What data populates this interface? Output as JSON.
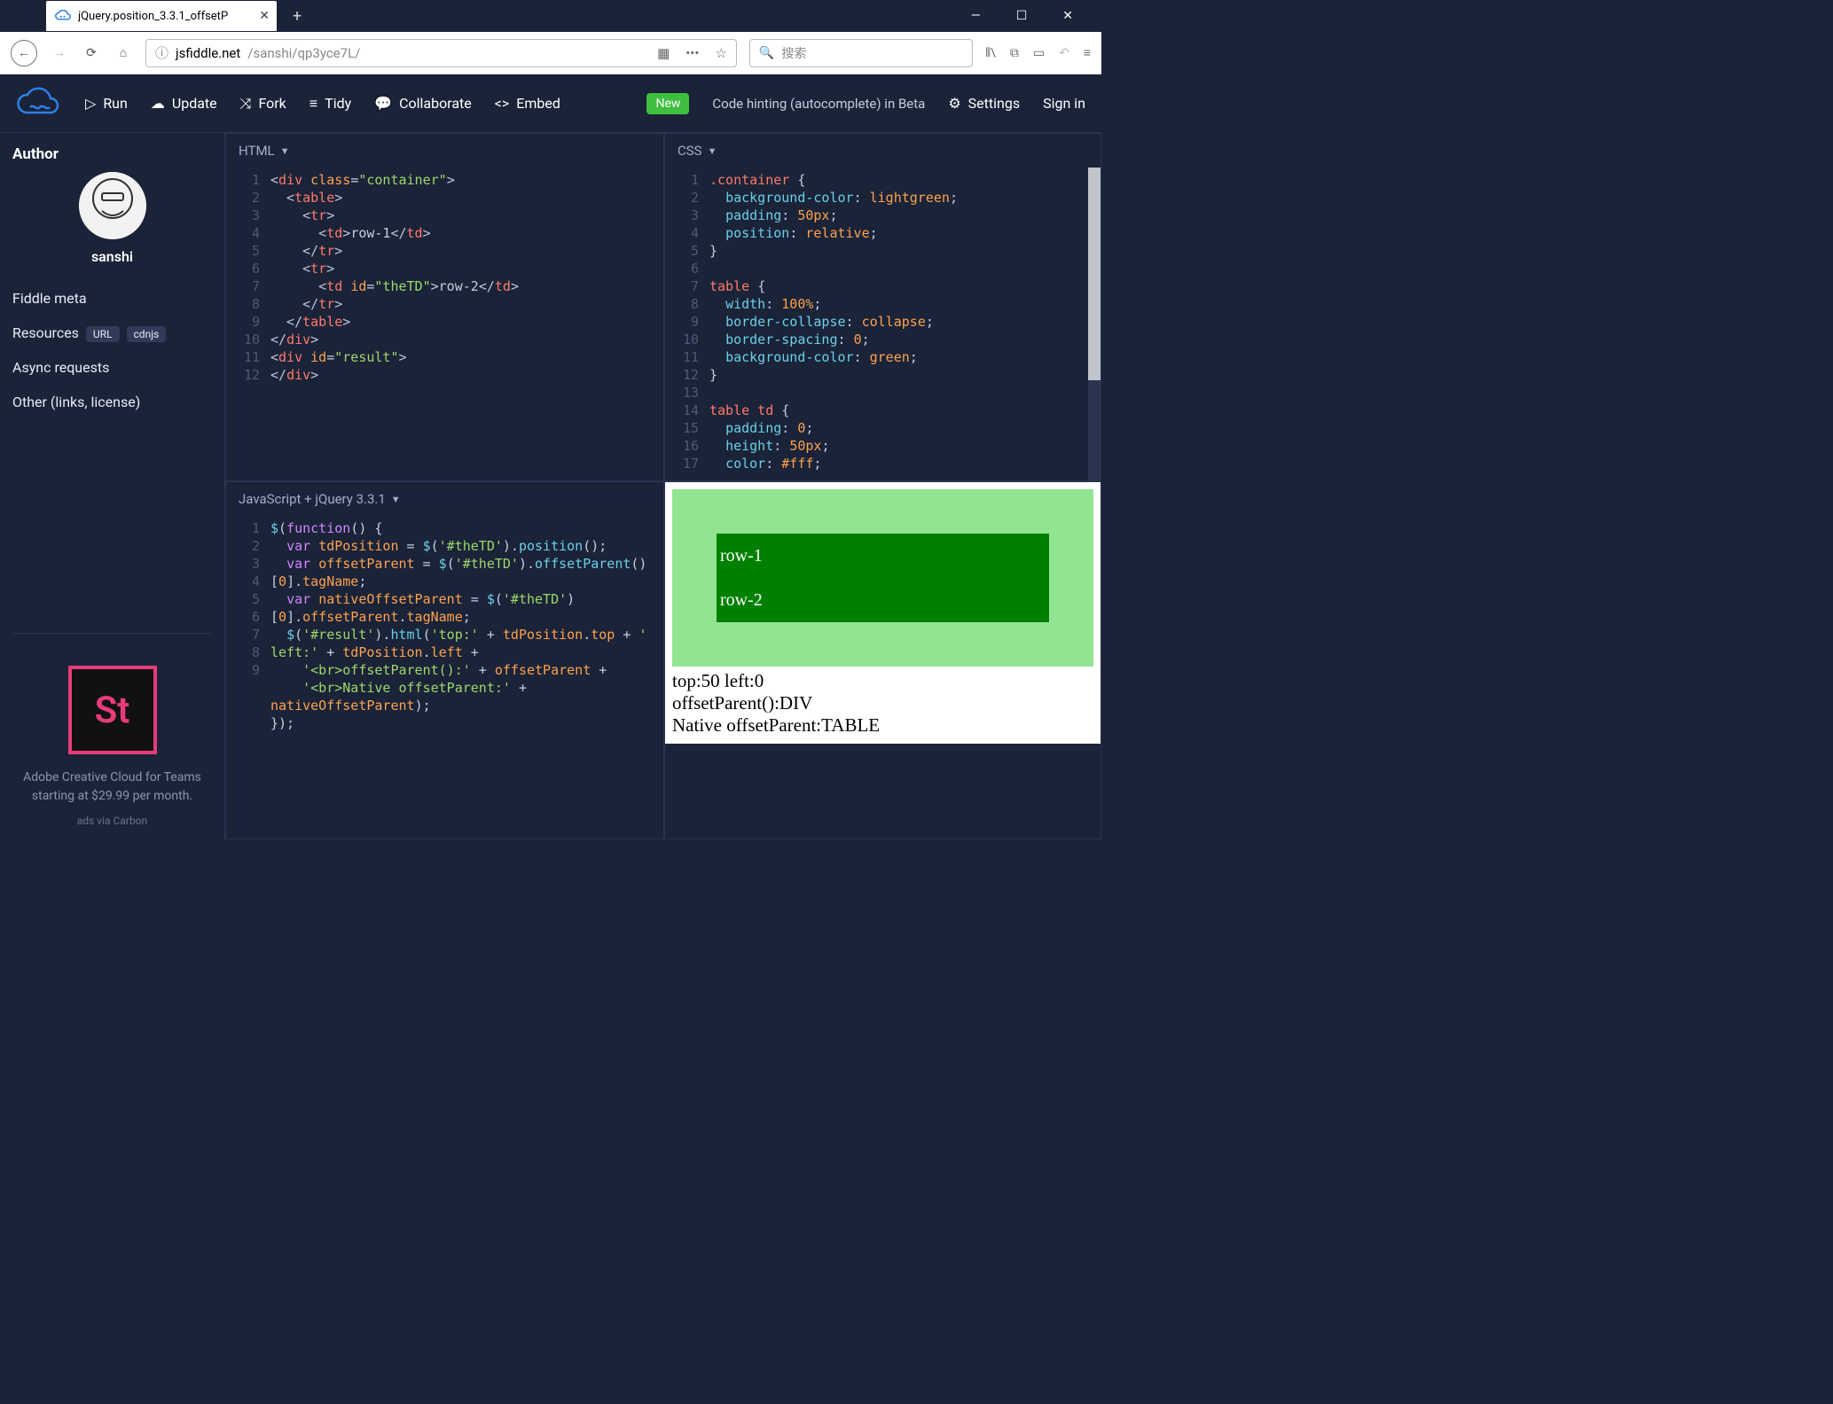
{
  "browser": {
    "tab_title": "jQuery.position_3.3.1_offsetP",
    "url_host": "jsfiddle.net",
    "url_path": "/sanshi/qp3yce7L/",
    "search_placeholder": "搜索"
  },
  "toolbar": {
    "run": "Run",
    "update": "Update",
    "fork": "Fork",
    "tidy": "Tidy",
    "collaborate": "Collaborate",
    "embed": "Embed",
    "new_label": "New",
    "hint": "Code hinting (autocomplete) in Beta",
    "settings": "Settings",
    "signin": "Sign in"
  },
  "sidebar": {
    "author_heading": "Author",
    "author_name": "sanshi",
    "links": {
      "fiddle_meta": "Fiddle meta",
      "resources": "Resources",
      "url_pill": "URL",
      "cdnjs_pill": "cdnjs",
      "async": "Async requests",
      "other": "Other (links, license)"
    },
    "ad": {
      "tile_text": "St",
      "copy": "Adobe Creative Cloud for Teams starting at $29.99 per month.",
      "via": "ads via Carbon"
    }
  },
  "panels": {
    "html_label": "HTML",
    "css_label": "CSS",
    "js_label": "JavaScript + jQuery 3.3.1"
  },
  "html_code": {
    "lines": [
      "1",
      "2",
      "3",
      "4",
      "5",
      "6",
      "7",
      "8",
      "9",
      "10",
      "11",
      "12"
    ],
    "l1": {
      "a": "<",
      "b": "div ",
      "c": "class",
      "d": "=",
      "e": "\"container\"",
      "f": ">"
    },
    "l2": {
      "a": "  <",
      "b": "table",
      "c": ">"
    },
    "l3": {
      "a": "    <",
      "b": "tr",
      "c": ">"
    },
    "l4": {
      "a": "      <",
      "b": "td",
      "c": ">",
      "d": "row-1",
      "e": "</",
      "f": "td",
      "g": ">"
    },
    "l5": {
      "a": "    </",
      "b": "tr",
      "c": ">"
    },
    "l6": {
      "a": "    <",
      "b": "tr",
      "c": ">"
    },
    "l7": {
      "a": "      <",
      "b": "td ",
      "c": "id",
      "d": "=",
      "e": "\"theTD\"",
      "f": ">",
      "g": "row-2",
      "h": "</",
      "i": "td",
      "j": ">"
    },
    "l8": {
      "a": "    </",
      "b": "tr",
      "c": ">"
    },
    "l9": {
      "a": "  </",
      "b": "table",
      "c": ">"
    },
    "l10": {
      "a": "</",
      "b": "div",
      "c": ">"
    },
    "l11": {
      "a": "<",
      "b": "div ",
      "c": "id",
      "d": "=",
      "e": "\"result\"",
      "f": ">"
    },
    "l12": {
      "a": "</",
      "b": "div",
      "c": ">"
    }
  },
  "css_code": {
    "lines": [
      "1",
      "2",
      "3",
      "4",
      "5",
      "6",
      "7",
      "8",
      "9",
      "10",
      "11",
      "12",
      "13",
      "14",
      "15",
      "16",
      "17"
    ],
    "l1": {
      "a": ".container ",
      "b": "{"
    },
    "l2": {
      "a": "  ",
      "b": "background-color",
      "c": ": ",
      "d": "lightgreen",
      "e": ";"
    },
    "l3": {
      "a": "  ",
      "b": "padding",
      "c": ": ",
      "d": "50px",
      "e": ";"
    },
    "l4": {
      "a": "  ",
      "b": "position",
      "c": ": ",
      "d": "relative",
      "e": ";"
    },
    "l5": {
      "a": "}"
    },
    "l6": {
      "a": ""
    },
    "l7": {
      "a": "table ",
      "b": "{"
    },
    "l8": {
      "a": "  ",
      "b": "width",
      "c": ": ",
      "d": "100%",
      "e": ";"
    },
    "l9": {
      "a": "  ",
      "b": "border-collapse",
      "c": ": ",
      "d": "collapse",
      "e": ";"
    },
    "l10": {
      "a": "  ",
      "b": "border-spacing",
      "c": ": ",
      "d": "0",
      "e": ";"
    },
    "l11": {
      "a": "  ",
      "b": "background-color",
      "c": ": ",
      "d": "green",
      "e": ";"
    },
    "l12": {
      "a": "}"
    },
    "l13": {
      "a": ""
    },
    "l14": {
      "a": "table td ",
      "b": "{"
    },
    "l15": {
      "a": "  ",
      "b": "padding",
      "c": ": ",
      "d": "0",
      "e": ";"
    },
    "l16": {
      "a": "  ",
      "b": "height",
      "c": ": ",
      "d": "50px",
      "e": ";"
    },
    "l17": {
      "a": "  ",
      "b": "color",
      "c": ": ",
      "d": "#fff",
      "e": ";"
    }
  },
  "js_code": {
    "lines": [
      "1",
      "2",
      "3",
      "4",
      "5",
      "6",
      "7",
      "8",
      "9"
    ],
    "rows": [
      [
        {
          "t": "$",
          "c": "tk-fn"
        },
        {
          "t": "(",
          "c": "tk-punct"
        },
        {
          "t": "function",
          "c": "tk-kw"
        },
        {
          "t": "() {",
          "c": "tk-punct"
        }
      ],
      [
        {
          "t": "  ",
          "c": ""
        },
        {
          "t": "var ",
          "c": "tk-kw"
        },
        {
          "t": "tdPosition",
          "c": "tk-var"
        },
        {
          "t": " = ",
          "c": "tk-punct"
        },
        {
          "t": "$",
          "c": "tk-fn"
        },
        {
          "t": "(",
          "c": "tk-punct"
        },
        {
          "t": "'#theTD'",
          "c": "tk-str"
        },
        {
          "t": ").",
          "c": "tk-punct"
        },
        {
          "t": "position",
          "c": "tk-fn"
        },
        {
          "t": "();",
          "c": "tk-punct"
        }
      ],
      [
        {
          "t": "  ",
          "c": ""
        },
        {
          "t": "var ",
          "c": "tk-kw"
        },
        {
          "t": "offsetParent",
          "c": "tk-var"
        },
        {
          "t": " = ",
          "c": "tk-punct"
        },
        {
          "t": "$",
          "c": "tk-fn"
        },
        {
          "t": "(",
          "c": "tk-punct"
        },
        {
          "t": "'#theTD'",
          "c": "tk-str"
        },
        {
          "t": ").",
          "c": "tk-punct"
        },
        {
          "t": "offsetParent",
          "c": "tk-fn"
        },
        {
          "t": "()\n[",
          "c": "tk-punct"
        },
        {
          "t": "0",
          "c": "tk-num"
        },
        {
          "t": "].",
          "c": "tk-punct"
        },
        {
          "t": "tagName",
          "c": "tk-obj"
        },
        {
          "t": ";",
          "c": "tk-punct"
        }
      ],
      [
        {
          "t": "  ",
          "c": ""
        },
        {
          "t": "var ",
          "c": "tk-kw"
        },
        {
          "t": "nativeOffsetParent",
          "c": "tk-var"
        },
        {
          "t": " = ",
          "c": "tk-punct"
        },
        {
          "t": "$",
          "c": "tk-fn"
        },
        {
          "t": "(",
          "c": "tk-punct"
        },
        {
          "t": "'#theTD'",
          "c": "tk-str"
        },
        {
          "t": ")\n[",
          "c": "tk-punct"
        },
        {
          "t": "0",
          "c": "tk-num"
        },
        {
          "t": "].",
          "c": "tk-punct"
        },
        {
          "t": "offsetParent",
          "c": "tk-obj"
        },
        {
          "t": ".",
          "c": "tk-punct"
        },
        {
          "t": "tagName",
          "c": "tk-obj"
        },
        {
          "t": ";",
          "c": "tk-punct"
        }
      ],
      [
        {
          "t": "  ",
          "c": ""
        },
        {
          "t": "$",
          "c": "tk-fn"
        },
        {
          "t": "(",
          "c": "tk-punct"
        },
        {
          "t": "'#result'",
          "c": "tk-str"
        },
        {
          "t": ").",
          "c": "tk-punct"
        },
        {
          "t": "html",
          "c": "tk-fn"
        },
        {
          "t": "(",
          "c": "tk-punct"
        },
        {
          "t": "'top:'",
          "c": "tk-str"
        },
        {
          "t": " + ",
          "c": "tk-punct"
        },
        {
          "t": "tdPosition",
          "c": "tk-obj"
        },
        {
          "t": ".",
          "c": "tk-punct"
        },
        {
          "t": "top",
          "c": "tk-obj"
        },
        {
          "t": " + ",
          "c": "tk-punct"
        },
        {
          "t": "'\nleft:'",
          "c": "tk-str"
        },
        {
          "t": " + ",
          "c": "tk-punct"
        },
        {
          "t": "tdPosition",
          "c": "tk-obj"
        },
        {
          "t": ".",
          "c": "tk-punct"
        },
        {
          "t": "left",
          "c": "tk-obj"
        },
        {
          "t": " +",
          "c": "tk-punct"
        }
      ],
      [
        {
          "t": "    ",
          "c": ""
        },
        {
          "t": "'<br>offsetParent():'",
          "c": "tk-str"
        },
        {
          "t": " + ",
          "c": "tk-punct"
        },
        {
          "t": "offsetParent",
          "c": "tk-obj"
        },
        {
          "t": " +",
          "c": "tk-punct"
        }
      ],
      [
        {
          "t": "    ",
          "c": ""
        },
        {
          "t": "'<br>Native offsetParent:'",
          "c": "tk-str"
        },
        {
          "t": " + \n",
          "c": "tk-punct"
        },
        {
          "t": "nativeOffsetParent",
          "c": "tk-obj"
        },
        {
          "t": ");",
          "c": "tk-punct"
        }
      ],
      [
        {
          "t": "});",
          "c": "tk-punct"
        }
      ],
      [
        {
          "t": "",
          "c": ""
        }
      ]
    ]
  },
  "result": {
    "row1": "row-1",
    "row2": "row-2",
    "output": "top:50 left:0\noffsetParent():DIV\nNative offsetParent:TABLE"
  }
}
